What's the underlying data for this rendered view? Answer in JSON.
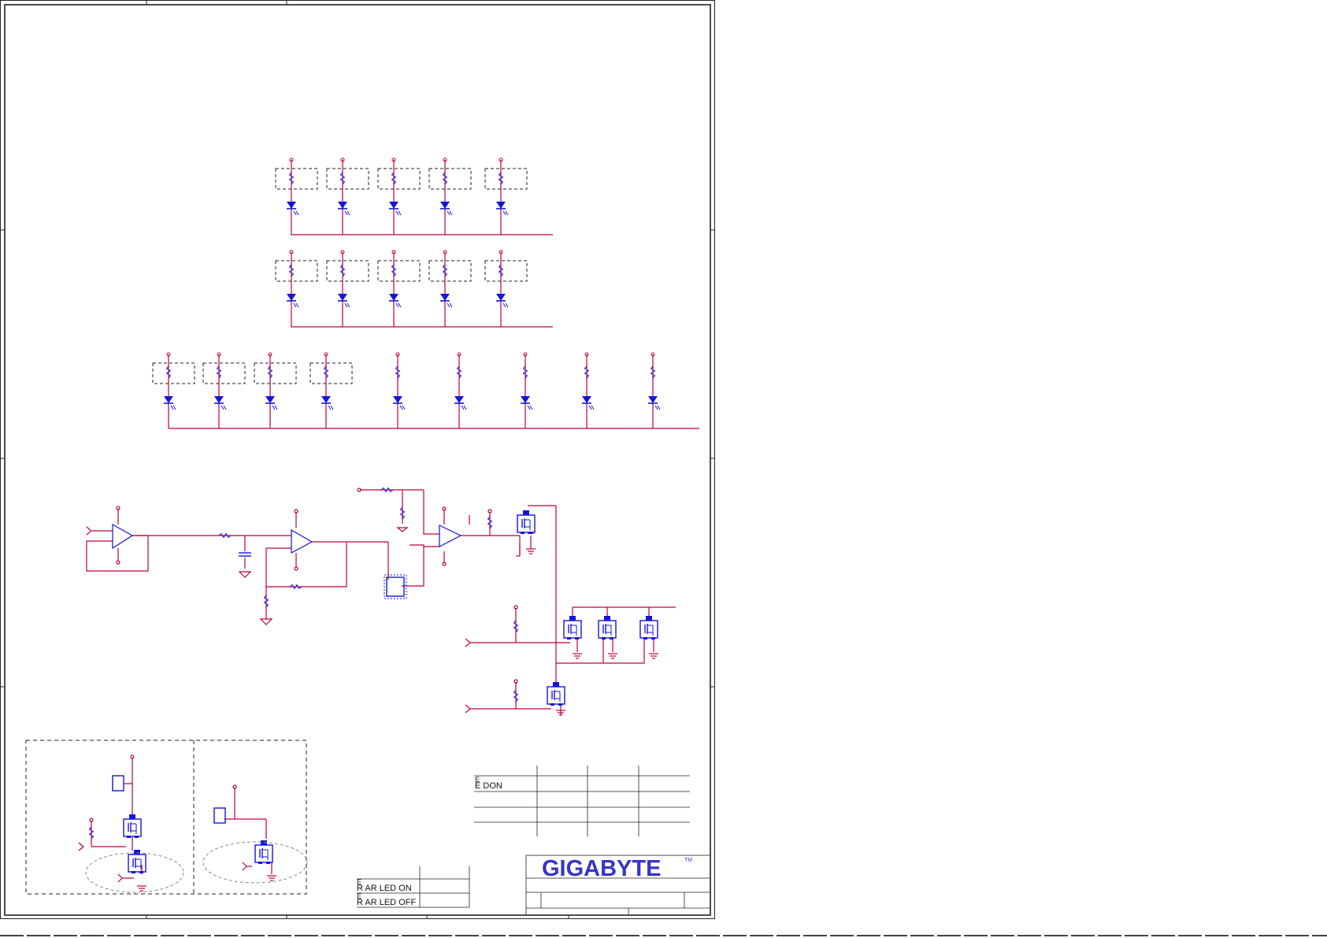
{
  "logo": {
    "text": "GIGABYTE",
    "mark": "TM"
  },
  "colors": {
    "wire": "#c0003c",
    "part": "#1515d8",
    "frame": "#222222",
    "logo": "#3535c8"
  },
  "led_table": {
    "rows": [
      "E",
      "E DON",
      "",
      ""
    ]
  },
  "rear_table": {
    "rows": [
      "E",
      "R AR LED ON",
      "E",
      "R AR LED OFF"
    ]
  },
  "led_bank_counts": {
    "row1": 5,
    "row2": 5,
    "row3": 9
  }
}
